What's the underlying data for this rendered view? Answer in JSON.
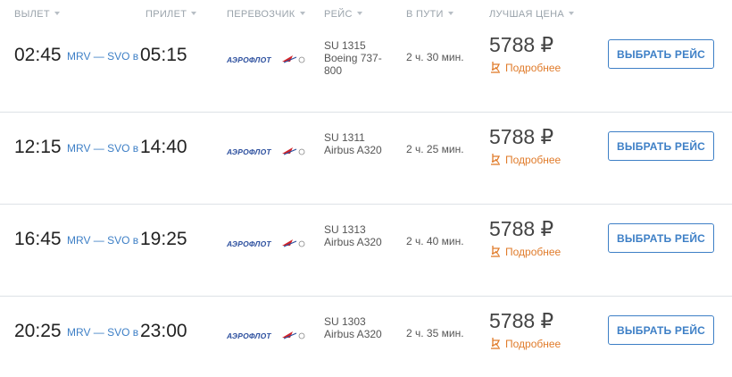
{
  "header": {
    "departure": "ВЫЛЕТ",
    "arrival": "ПРИЛЕТ",
    "carrier": "ПЕРЕВОЗЧИК",
    "flight": "РЕЙС",
    "duration": "В ПУТИ",
    "best_price": "ЛУЧШАЯ ЦЕНА"
  },
  "airline_logo_text": "АЭРОФЛОТ",
  "details_label": "Подробнее",
  "select_label": "ВЫБРАТЬ РЕЙС",
  "colors": {
    "accent": "#3d7fc6",
    "details": "#e07b2a",
    "divider": "#dde2e6"
  },
  "flights": [
    {
      "dep_time": "02:45",
      "route": "MRV — SVO в",
      "arr_time": "05:15",
      "flight_no": "SU 1315",
      "aircraft": "Boeing 737-800",
      "duration": "2 ч. 30 мин.",
      "price": "5788 ₽"
    },
    {
      "dep_time": "12:15",
      "route": "MRV — SVO в",
      "arr_time": "14:40",
      "flight_no": "SU 1311",
      "aircraft": "Airbus A320",
      "duration": "2 ч. 25 мин.",
      "price": "5788 ₽"
    },
    {
      "dep_time": "16:45",
      "route": "MRV — SVO в",
      "arr_time": "19:25",
      "flight_no": "SU 1313",
      "aircraft": "Airbus A320",
      "duration": "2 ч. 40 мин.",
      "price": "5788 ₽"
    },
    {
      "dep_time": "20:25",
      "route": "MRV — SVO в",
      "arr_time": "23:00",
      "flight_no": "SU 1303",
      "aircraft": "Airbus A320",
      "duration": "2 ч. 35 мин.",
      "price": "5788 ₽"
    }
  ]
}
